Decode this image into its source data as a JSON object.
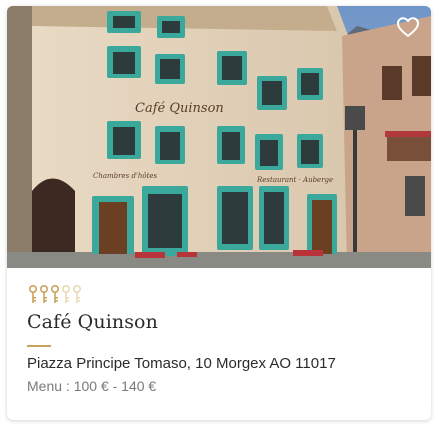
{
  "restaurant": {
    "name": "Café Quinson",
    "address": "Piazza Principe Tomaso, 10 Morgex AO 11017",
    "price": "Menu : 100 € - 140 €",
    "rating": {
      "filled_keys": 3,
      "total_keys": 5
    },
    "photo_sign": {
      "main": "Café Quinson",
      "left": "Chambres d'hôtes",
      "right": "Restaurant · Auberge"
    }
  },
  "colors": {
    "accent": "#c9a35d",
    "key_empty": "#ead9b3",
    "shutter": "#3aa89b"
  },
  "icons": {
    "favorite": "heart-outline-icon",
    "rating": "key-icon"
  }
}
